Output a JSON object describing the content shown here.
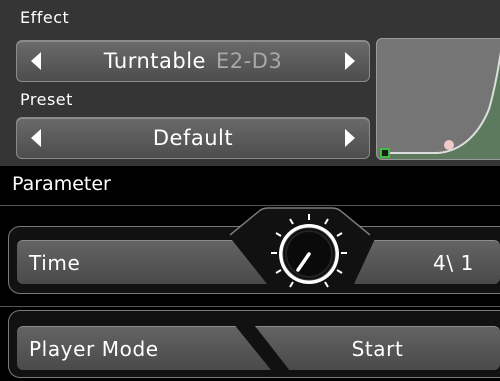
{
  "effect": {
    "label": "Effect",
    "name": "Turntable",
    "range": "E2-D3"
  },
  "preset": {
    "label": "Preset",
    "name": "Default"
  },
  "parameter": {
    "header": "Parameter",
    "time": {
      "label": "Time",
      "value": "4\\ 1"
    },
    "player_mode": {
      "label": "Player Mode",
      "value": "Start"
    }
  },
  "icons": {
    "left": "arrow-left-icon",
    "right": "arrow-right-icon",
    "knob": "knob-icon"
  },
  "colors": {
    "curve_fill": "#5e7a5e",
    "curve_line": "#dedede",
    "curve_point": "#f0c8c8",
    "anchor": "#3fbf3f"
  }
}
